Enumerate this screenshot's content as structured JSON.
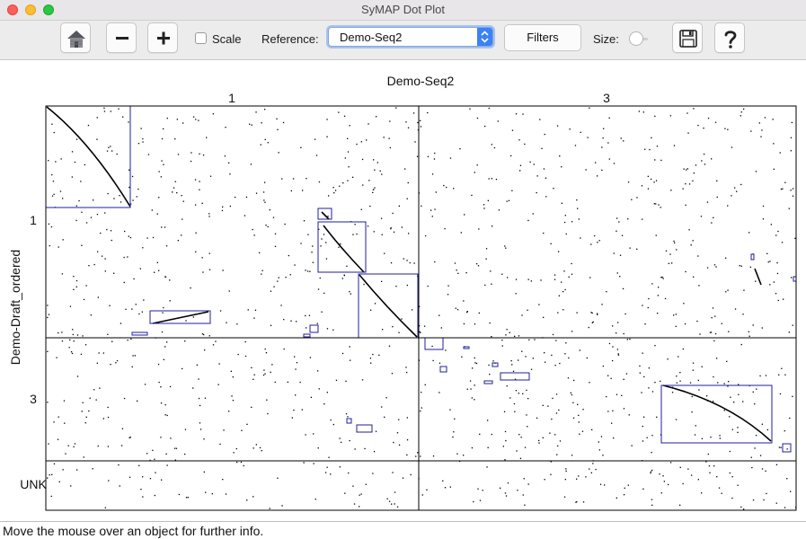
{
  "window": {
    "title": "SyMAP Dot Plot"
  },
  "toolbar": {
    "scale_label": "Scale",
    "reference_label": "Reference:",
    "reference_value": "Demo-Seq2",
    "filters_label": "Filters",
    "size_label": "Size:"
  },
  "plot": {
    "x_title": "Demo-Seq2",
    "y_title": "Demo-Draft_ordered",
    "x_chroms": [
      "1",
      "3"
    ],
    "y_chroms": [
      "1",
      "3",
      "UNK"
    ],
    "frame_color": "#000000",
    "block_color": "#1f1f9c"
  },
  "status": {
    "text": "Move the mouse over an object for further info."
  },
  "icons": [
    "home-icon",
    "zoom-out-icon",
    "zoom-in-icon",
    "save-icon",
    "help-icon"
  ]
}
